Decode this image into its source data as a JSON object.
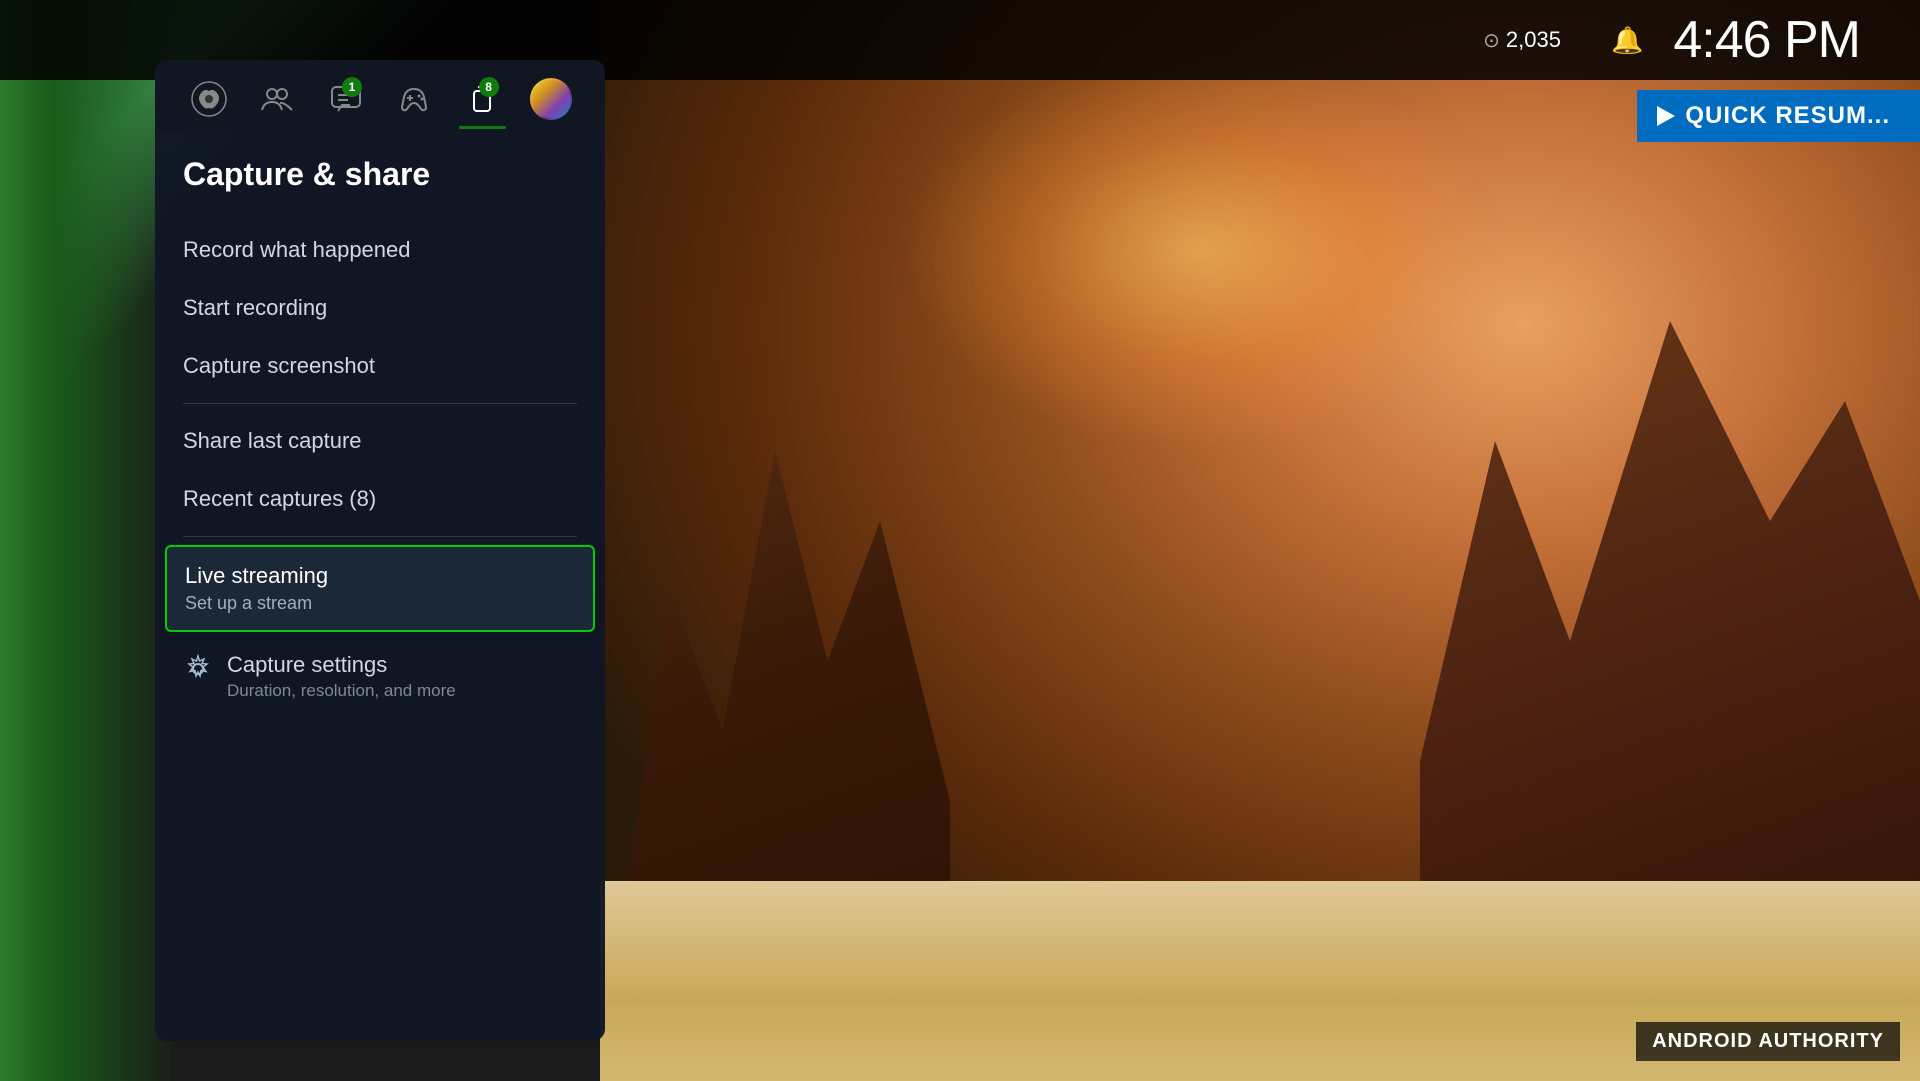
{
  "background": {
    "description": "Xbox game desert canyon scene"
  },
  "topBar": {
    "credits": "2,035",
    "time": "4:46 PM",
    "creditsIcon": "⊙",
    "bellIcon": "🔔"
  },
  "quickResume": {
    "label": "QUICK RESUM..."
  },
  "nav": {
    "items": [
      {
        "id": "xbox",
        "icon": "xbox",
        "label": "Xbox",
        "badge": null,
        "active": false
      },
      {
        "id": "people",
        "icon": "people",
        "label": "People",
        "badge": null,
        "active": false
      },
      {
        "id": "chat",
        "icon": "chat",
        "label": "Chat",
        "badge": "1",
        "active": false
      },
      {
        "id": "controller",
        "icon": "controller",
        "label": "Controller",
        "badge": null,
        "active": false
      },
      {
        "id": "share",
        "icon": "share",
        "label": "Share",
        "badge": "8",
        "active": true
      },
      {
        "id": "profile",
        "icon": "avatar",
        "label": "Profile",
        "badge": null,
        "active": false
      }
    ]
  },
  "panel": {
    "title": "Capture & share",
    "menuItems": [
      {
        "id": "record-what-happened",
        "label": "Record what happened",
        "subtitle": null,
        "divider": false
      },
      {
        "id": "start-recording",
        "label": "Start recording",
        "subtitle": null,
        "divider": false
      },
      {
        "id": "capture-screenshot",
        "label": "Capture screenshot",
        "subtitle": null,
        "divider": true
      },
      {
        "id": "share-last-capture",
        "label": "Share last capture",
        "subtitle": null,
        "divider": false
      },
      {
        "id": "recent-captures",
        "label": "Recent captures (8)",
        "subtitle": null,
        "divider": true
      }
    ],
    "highlightedItem": {
      "id": "live-streaming",
      "title": "Live streaming",
      "subtitle": "Set up a stream"
    },
    "settingsItem": {
      "id": "capture-settings",
      "title": "Capture settings",
      "subtitle": "Duration, resolution, and more"
    }
  },
  "watermark": {
    "text": "ANDROID AUTHORITY"
  }
}
